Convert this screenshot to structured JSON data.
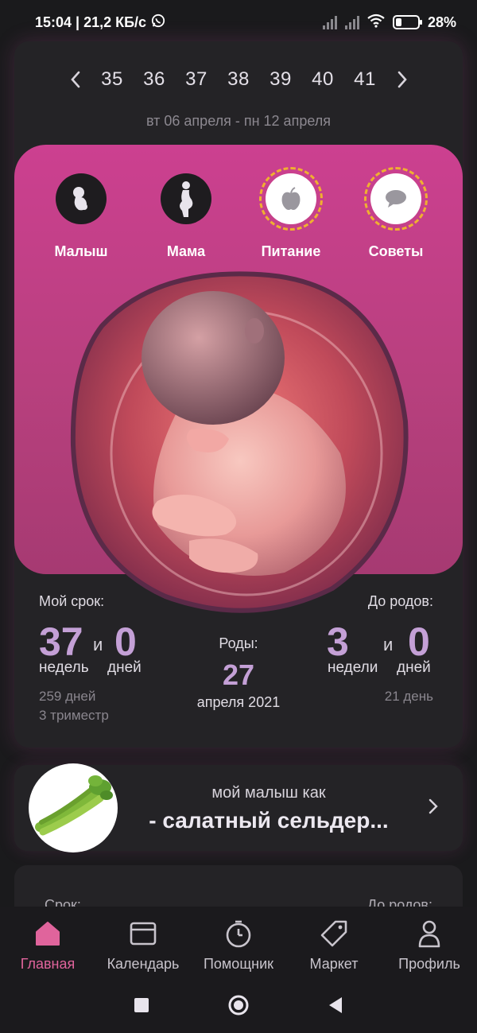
{
  "status": {
    "time_speed": "15:04 | 21,2 КБ/с",
    "battery": "28%",
    "battery_level": 0.28
  },
  "weeks": {
    "prev_icon": "chevron-left-icon",
    "next_icon": "chevron-right-icon",
    "items": [
      "35",
      "36",
      "37",
      "38",
      "39",
      "40",
      "41"
    ],
    "range": "вт 06 апреля - пн 12 апреля"
  },
  "categories": [
    {
      "label": "Малыш",
      "icon": "baby-icon"
    },
    {
      "label": "Мама",
      "icon": "mother-icon"
    },
    {
      "label": "Питание",
      "icon": "apple-icon"
    },
    {
      "label": "Советы",
      "icon": "chat-icon"
    }
  ],
  "stats": {
    "my_term_label": "Мой срок:",
    "weeks_value": "37",
    "and": "и",
    "days_value": "0",
    "weeks_unit": "недель",
    "days_unit": "дней",
    "total_days": "259 дней",
    "trimester": "3 триместр",
    "birth_label": "Роды:",
    "birth_day": "27",
    "birth_month_year": "апреля 2021",
    "until_label": "До родов:",
    "until_weeks": "3",
    "until_and": "и",
    "until_days": "0",
    "until_weeks_unit": "недели",
    "until_days_unit": "дней",
    "until_day_count": "21 день"
  },
  "baby_size": {
    "subtitle": "мой малыш как",
    "title": "- салатный сельдер..."
  },
  "peek": {
    "left": "Срок:",
    "right": "До родов:"
  },
  "nav": [
    {
      "label": "Главная",
      "icon": "home-icon"
    },
    {
      "label": "Календарь",
      "icon": "calendar-icon"
    },
    {
      "label": "Помощник",
      "icon": "stopwatch-icon"
    },
    {
      "label": "Маркет",
      "icon": "tag-icon"
    },
    {
      "label": "Профиль",
      "icon": "profile-icon"
    }
  ],
  "colors": {
    "accent_pink": "#e0649c",
    "panel_pink": "#c4408a",
    "number_lilac": "#c4a0d6"
  }
}
